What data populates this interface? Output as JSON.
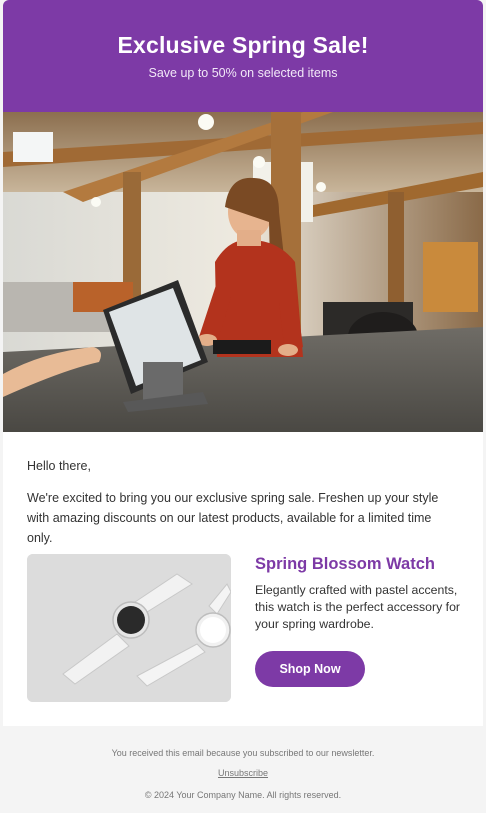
{
  "header": {
    "title": "Exclusive Spring Sale!",
    "subtitle": "Save up to 50% on selected items"
  },
  "content": {
    "greeting": "Hello there,",
    "intro": "We're excited to bring you our exclusive spring sale. Freshen up your style with amazing discounts on our latest products, available for a limited time only."
  },
  "product": {
    "title": "Spring Blossom Watch",
    "description": "Elegantly crafted with pastel accents, this watch is the perfect accessory for your spring wardrobe.",
    "button_label": "Shop Now"
  },
  "footer": {
    "notice": "You received this email because you subscribed to our newsletter.",
    "unsubscribe_label": "Unsubscribe",
    "copyright": "© 2024 Your Company Name. All rights reserved."
  },
  "colors": {
    "brand": "#7d3aa6",
    "background": "#f4f4f4",
    "card": "#ffffff"
  }
}
